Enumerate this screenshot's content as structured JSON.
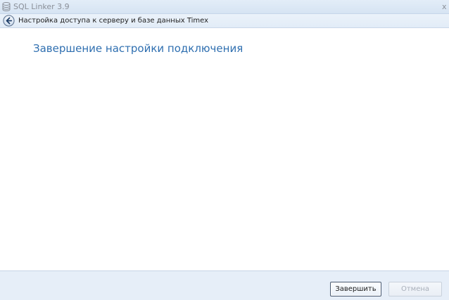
{
  "window": {
    "title": "SQL Linker 3.9",
    "close_glyph": "x"
  },
  "header": {
    "title": "Настройка доступа к серверу и базе данных Timex",
    "back_icon": "back-arrow-icon"
  },
  "main": {
    "heading": "Завершение настройки подключения"
  },
  "footer": {
    "finish_label": "Завершить",
    "cancel_label": "Отмена",
    "cancel_enabled": false
  },
  "colors": {
    "heading": "#2f6fb0",
    "titlebar": "#dde8f5",
    "footer": "#e6eef8"
  }
}
